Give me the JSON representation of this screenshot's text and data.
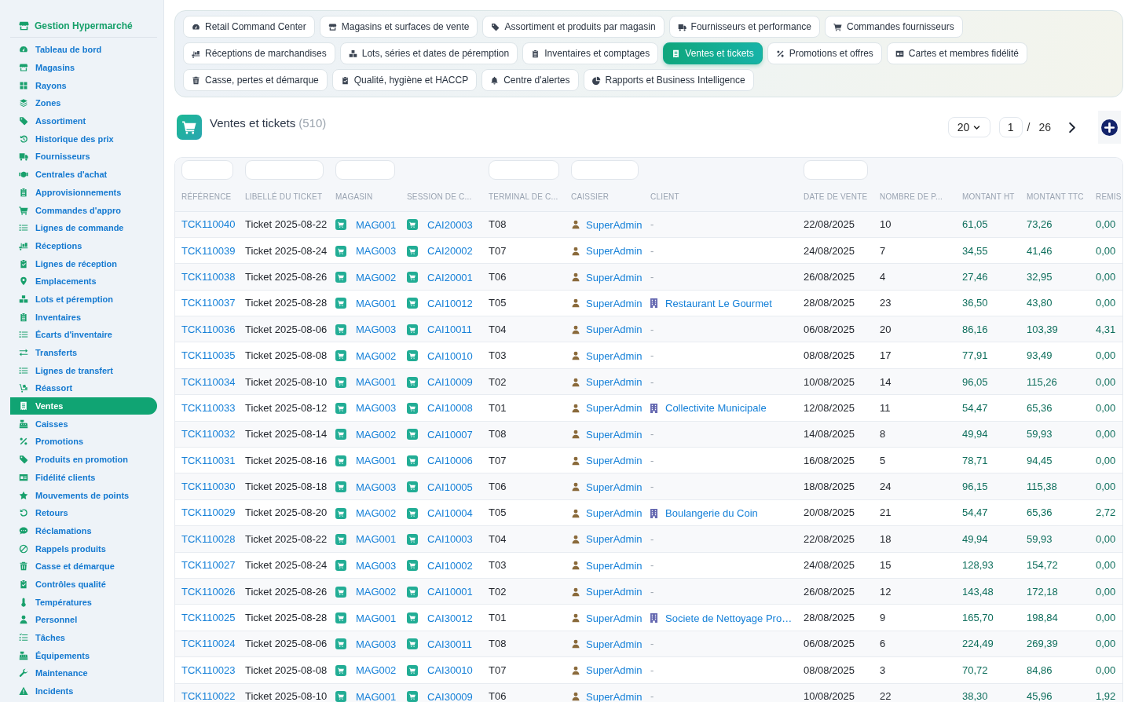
{
  "sidebar": {
    "brand": "Gestion Hypermarché",
    "items": [
      {
        "label": "Tableau de bord",
        "selected": false
      },
      {
        "label": "Magasins",
        "selected": false
      },
      {
        "label": "Rayons",
        "selected": false
      },
      {
        "label": "Zones",
        "selected": false
      },
      {
        "label": "Assortiment",
        "selected": false
      },
      {
        "label": "Historique des prix",
        "selected": false
      },
      {
        "label": "Fournisseurs",
        "selected": false
      },
      {
        "label": "Centrales d'achat",
        "selected": false
      },
      {
        "label": "Approvisionnements",
        "selected": false
      },
      {
        "label": "Commandes d'appro",
        "selected": false
      },
      {
        "label": "Lignes de commande",
        "selected": false
      },
      {
        "label": "Réceptions",
        "selected": false
      },
      {
        "label": "Lignes de réception",
        "selected": false
      },
      {
        "label": "Emplacements",
        "selected": false
      },
      {
        "label": "Lots et péremption",
        "selected": false
      },
      {
        "label": "Inventaires",
        "selected": false
      },
      {
        "label": "Écarts d'inventaire",
        "selected": false
      },
      {
        "label": "Transferts",
        "selected": false
      },
      {
        "label": "Lignes de transfert",
        "selected": false
      },
      {
        "label": "Réassort",
        "selected": false
      },
      {
        "label": "Ventes",
        "selected": true
      },
      {
        "label": "Caisses",
        "selected": false
      },
      {
        "label": "Promotions",
        "selected": false
      },
      {
        "label": "Produits en promotion",
        "selected": false
      },
      {
        "label": "Fidélité clients",
        "selected": false
      },
      {
        "label": "Mouvements de points",
        "selected": false
      },
      {
        "label": "Retours",
        "selected": false
      },
      {
        "label": "Réclamations",
        "selected": false
      },
      {
        "label": "Rappels produits",
        "selected": false
      },
      {
        "label": "Casse et démarque",
        "selected": false
      },
      {
        "label": "Contrôles qualité",
        "selected": false
      },
      {
        "label": "Températures",
        "selected": false
      },
      {
        "label": "Personnel",
        "selected": false
      },
      {
        "label": "Tâches",
        "selected": false
      },
      {
        "label": "Équipements",
        "selected": false
      },
      {
        "label": "Maintenance",
        "selected": false
      },
      {
        "label": "Incidents",
        "selected": false
      }
    ]
  },
  "nav_tabs": [
    {
      "label": "Retail Command Center",
      "selected": false
    },
    {
      "label": "Magasins et surfaces de vente",
      "selected": false
    },
    {
      "label": "Assortiment et produits par magasin",
      "selected": false
    },
    {
      "label": "Fournisseurs et performance",
      "selected": false
    },
    {
      "label": "Commandes fournisseurs",
      "selected": false
    },
    {
      "label": "Réceptions de marchandises",
      "selected": false
    },
    {
      "label": "Lots, séries et dates de péremption",
      "selected": false
    },
    {
      "label": "Inventaires et comptages",
      "selected": false
    },
    {
      "label": "Ventes et tickets",
      "selected": true
    },
    {
      "label": "Promotions et offres",
      "selected": false
    },
    {
      "label": "Cartes et membres fidélité",
      "selected": false
    },
    {
      "label": "Casse, pertes et démarque",
      "selected": false
    },
    {
      "label": "Qualité, hygiène et HACCP",
      "selected": false
    },
    {
      "label": "Centre d'alertes",
      "selected": false
    },
    {
      "label": "Rapports et Business Intelligence",
      "selected": false
    }
  ],
  "header": {
    "title": "Ventes et tickets",
    "count": "(510)"
  },
  "pager": {
    "page_size": "20",
    "page": "1",
    "separator": "/",
    "total_pages": "26"
  },
  "table": {
    "columns": [
      {
        "label": "RÉFÉRENCE",
        "filter": true
      },
      {
        "label": "LIBELLÉ DU TICKET",
        "filter": true
      },
      {
        "label": "MAGASIN",
        "filter": true
      },
      {
        "label": "SESSION DE C...",
        "filter": false
      },
      {
        "label": "TERMINAL DE C...",
        "filter": true
      },
      {
        "label": "CAISSIER",
        "filter": true
      },
      {
        "label": "CLIENT",
        "filter": false
      },
      {
        "label": "DATE DE VENTE",
        "filter": true
      },
      {
        "label": "NOMBRE DE P...",
        "filter": false
      },
      {
        "label": "MONTANT HT",
        "filter": false
      },
      {
        "label": "MONTANT TTC",
        "filter": false
      },
      {
        "label": "REMIS",
        "filter": false
      }
    ],
    "rows": [
      {
        "reference": "TCK110040",
        "label": "Ticket 2025-08-22",
        "store": "MAG001",
        "session": "CAI20003",
        "terminal": "T08",
        "cashier": "SuperAdmin",
        "client": {
          "kind": "none",
          "text": "-"
        },
        "date": "22/08/2025",
        "items": "10",
        "amount_ht": "61,05",
        "amount_ttc": "73,26",
        "discount": "0,00"
      },
      {
        "reference": "TCK110039",
        "label": "Ticket 2025-08-24",
        "store": "MAG003",
        "session": "CAI20002",
        "terminal": "T07",
        "cashier": "SuperAdmin",
        "client": {
          "kind": "none",
          "text": "-"
        },
        "date": "24/08/2025",
        "items": "7",
        "amount_ht": "34,55",
        "amount_ttc": "41,46",
        "discount": "0,00"
      },
      {
        "reference": "TCK110038",
        "label": "Ticket 2025-08-26",
        "store": "MAG002",
        "session": "CAI20001",
        "terminal": "T06",
        "cashier": "SuperAdmin",
        "client": {
          "kind": "none",
          "text": "-"
        },
        "date": "26/08/2025",
        "items": "4",
        "amount_ht": "27,46",
        "amount_ttc": "32,95",
        "discount": "0,00"
      },
      {
        "reference": "TCK110037",
        "label": "Ticket 2025-08-28",
        "store": "MAG001",
        "session": "CAI10012",
        "terminal": "T05",
        "cashier": "SuperAdmin",
        "client": {
          "kind": "company",
          "text": "Restaurant Le Gourmet"
        },
        "date": "28/08/2025",
        "items": "23",
        "amount_ht": "36,50",
        "amount_ttc": "43,80",
        "discount": "0,00"
      },
      {
        "reference": "TCK110036",
        "label": "Ticket 2025-08-06",
        "store": "MAG003",
        "session": "CAI10011",
        "terminal": "T04",
        "cashier": "SuperAdmin",
        "client": {
          "kind": "none",
          "text": "-"
        },
        "date": "06/08/2025",
        "items": "20",
        "amount_ht": "86,16",
        "amount_ttc": "103,39",
        "discount": "4,31"
      },
      {
        "reference": "TCK110035",
        "label": "Ticket 2025-08-08",
        "store": "MAG002",
        "session": "CAI10010",
        "terminal": "T03",
        "cashier": "SuperAdmin",
        "client": {
          "kind": "none",
          "text": "-"
        },
        "date": "08/08/2025",
        "items": "17",
        "amount_ht": "77,91",
        "amount_ttc": "93,49",
        "discount": "0,00"
      },
      {
        "reference": "TCK110034",
        "label": "Ticket 2025-08-10",
        "store": "MAG001",
        "session": "CAI10009",
        "terminal": "T02",
        "cashier": "SuperAdmin",
        "client": {
          "kind": "none",
          "text": "-"
        },
        "date": "10/08/2025",
        "items": "14",
        "amount_ht": "96,05",
        "amount_ttc": "115,26",
        "discount": "0,00"
      },
      {
        "reference": "TCK110033",
        "label": "Ticket 2025-08-12",
        "store": "MAG003",
        "session": "CAI10008",
        "terminal": "T01",
        "cashier": "SuperAdmin",
        "client": {
          "kind": "company",
          "text": "Collectivite Municipale"
        },
        "date": "12/08/2025",
        "items": "11",
        "amount_ht": "54,47",
        "amount_ttc": "65,36",
        "discount": "0,00"
      },
      {
        "reference": "TCK110032",
        "label": "Ticket 2025-08-14",
        "store": "MAG002",
        "session": "CAI10007",
        "terminal": "T08",
        "cashier": "SuperAdmin",
        "client": {
          "kind": "none",
          "text": "-"
        },
        "date": "14/08/2025",
        "items": "8",
        "amount_ht": "49,94",
        "amount_ttc": "59,93",
        "discount": "0,00"
      },
      {
        "reference": "TCK110031",
        "label": "Ticket 2025-08-16",
        "store": "MAG001",
        "session": "CAI10006",
        "terminal": "T07",
        "cashier": "SuperAdmin",
        "client": {
          "kind": "none",
          "text": "-"
        },
        "date": "16/08/2025",
        "items": "5",
        "amount_ht": "78,71",
        "amount_ttc": "94,45",
        "discount": "0,00"
      },
      {
        "reference": "TCK110030",
        "label": "Ticket 2025-08-18",
        "store": "MAG003",
        "session": "CAI10005",
        "terminal": "T06",
        "cashier": "SuperAdmin",
        "client": {
          "kind": "none",
          "text": "-"
        },
        "date": "18/08/2025",
        "items": "24",
        "amount_ht": "96,15",
        "amount_ttc": "115,38",
        "discount": "0,00"
      },
      {
        "reference": "TCK110029",
        "label": "Ticket 2025-08-20",
        "store": "MAG002",
        "session": "CAI10004",
        "terminal": "T05",
        "cashier": "SuperAdmin",
        "client": {
          "kind": "company",
          "text": "Boulangerie du Coin"
        },
        "date": "20/08/2025",
        "items": "21",
        "amount_ht": "54,47",
        "amount_ttc": "65,36",
        "discount": "2,72"
      },
      {
        "reference": "TCK110028",
        "label": "Ticket 2025-08-22",
        "store": "MAG001",
        "session": "CAI10003",
        "terminal": "T04",
        "cashier": "SuperAdmin",
        "client": {
          "kind": "none",
          "text": "-"
        },
        "date": "22/08/2025",
        "items": "18",
        "amount_ht": "49,94",
        "amount_ttc": "59,93",
        "discount": "0,00"
      },
      {
        "reference": "TCK110027",
        "label": "Ticket 2025-08-24",
        "store": "MAG003",
        "session": "CAI10002",
        "terminal": "T03",
        "cashier": "SuperAdmin",
        "client": {
          "kind": "none",
          "text": "-"
        },
        "date": "24/08/2025",
        "items": "15",
        "amount_ht": "128,93",
        "amount_ttc": "154,72",
        "discount": "0,00"
      },
      {
        "reference": "TCK110026",
        "label": "Ticket 2025-08-26",
        "store": "MAG002",
        "session": "CAI10001",
        "terminal": "T02",
        "cashier": "SuperAdmin",
        "client": {
          "kind": "none",
          "text": "-"
        },
        "date": "26/08/2025",
        "items": "12",
        "amount_ht": "143,48",
        "amount_ttc": "172,18",
        "discount": "0,00"
      },
      {
        "reference": "TCK110025",
        "label": "Ticket 2025-08-28",
        "store": "MAG001",
        "session": "CAI30012",
        "terminal": "T01",
        "cashier": "SuperAdmin",
        "client": {
          "kind": "company",
          "text": "Societe de Nettoyage Pro…"
        },
        "date": "28/08/2025",
        "items": "9",
        "amount_ht": "165,70",
        "amount_ttc": "198,84",
        "discount": "0,00"
      },
      {
        "reference": "TCK110024",
        "label": "Ticket 2025-08-06",
        "store": "MAG003",
        "session": "CAI30011",
        "terminal": "T08",
        "cashier": "SuperAdmin",
        "client": {
          "kind": "none",
          "text": "-"
        },
        "date": "06/08/2025",
        "items": "6",
        "amount_ht": "224,49",
        "amount_ttc": "269,39",
        "discount": "0,00"
      },
      {
        "reference": "TCK110023",
        "label": "Ticket 2025-08-08",
        "store": "MAG002",
        "session": "CAI30010",
        "terminal": "T07",
        "cashier": "SuperAdmin",
        "client": {
          "kind": "none",
          "text": "-"
        },
        "date": "08/08/2025",
        "items": "3",
        "amount_ht": "70,72",
        "amount_ttc": "84,86",
        "discount": "0,00"
      },
      {
        "reference": "TCK110022",
        "label": "Ticket 2025-08-10",
        "store": "MAG001",
        "session": "CAI30009",
        "terminal": "T06",
        "cashier": "SuperAdmin",
        "client": {
          "kind": "none",
          "text": "-"
        },
        "date": "10/08/2025",
        "items": "22",
        "amount_ht": "38,30",
        "amount_ttc": "45,96",
        "discount": "1,92"
      }
    ]
  }
}
